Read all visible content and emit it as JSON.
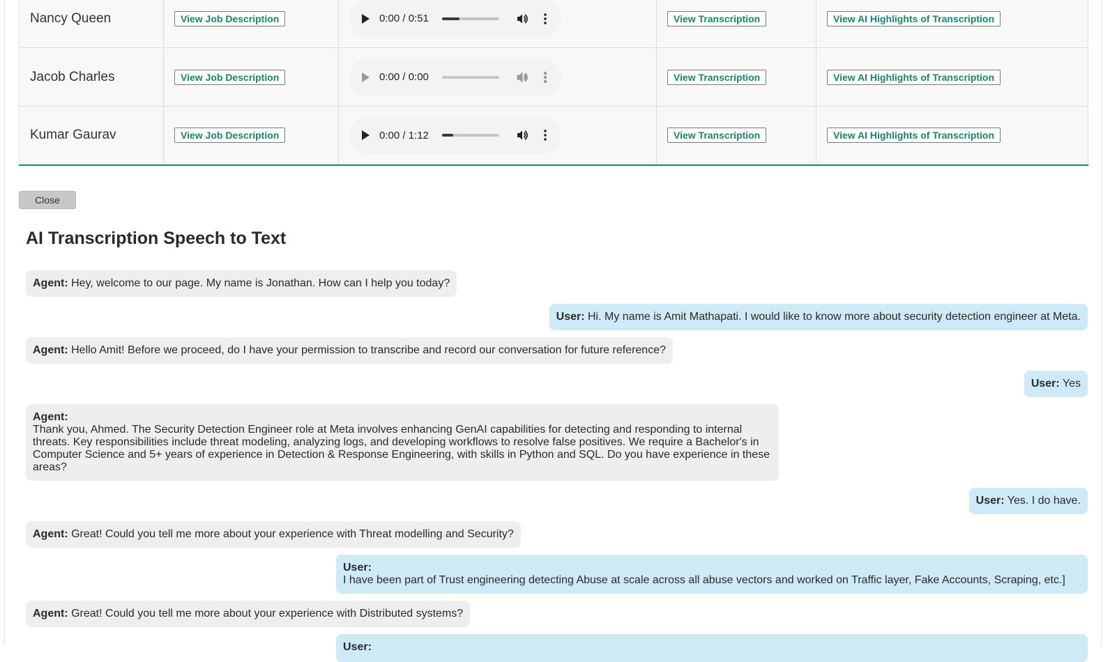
{
  "table": {
    "rows": [
      {
        "name": "Nancy Queen",
        "job_btn": "View Job Description",
        "audio": {
          "time": "0:00 / 0:51",
          "progress": 0.3,
          "disabled": false
        },
        "transcription_btn": "View Transcription",
        "highlights_btn": "View AI Highlights of Transcription"
      },
      {
        "name": "Jacob Charles",
        "job_btn": "View Job Description",
        "audio": {
          "time": "0:00 / 0:00",
          "progress": 0,
          "disabled": true
        },
        "transcription_btn": "View Transcription",
        "highlights_btn": "View AI Highlights of Transcription"
      },
      {
        "name": "Kumar Gaurav",
        "job_btn": "View Job Description",
        "audio": {
          "time": "0:00 / 1:12",
          "progress": 0.2,
          "disabled": false
        },
        "transcription_btn": "View Transcription",
        "highlights_btn": "View AI Highlights of Transcription"
      }
    ]
  },
  "close_label": "Close",
  "section_title": "AI Transcription Speech to Text",
  "messages": [
    {
      "role": "agent",
      "speaker": "Agent:",
      "text": "Hey, welcome to our page. My name is Jonathan. How can I help you today?"
    },
    {
      "role": "user",
      "speaker": "User:",
      "text": "Hi. My name is Amit Mathapati. I would like to know more about security detection engineer at Meta."
    },
    {
      "role": "agent",
      "speaker": "Agent:",
      "text": "Hello Amit! Before we proceed, do I have your permission to transcribe and record our conversation for future reference?"
    },
    {
      "role": "user",
      "speaker": "User:",
      "text": "Yes"
    },
    {
      "role": "agent",
      "speaker": "Agent:",
      "text": "Thank you, Ahmed. The Security Detection Engineer role at Meta involves enhancing GenAI capabilities for detecting and responding to internal threats. Key responsibilities include threat modeling, analyzing logs, and developing workflows to resolve false positives. We require a Bachelor's in Computer Science and 5+ years of experience in Detection & Response Engineering, with skills in Python and SQL. Do you have experience in these areas?"
    },
    {
      "role": "user",
      "speaker": "User:",
      "text": "Yes. I do have."
    },
    {
      "role": "agent",
      "speaker": "Agent:",
      "text": "Great! Could you tell me more about your experience with Threat modelling and Security?"
    },
    {
      "role": "user",
      "speaker": "User:",
      "text": "I have been part of Trust engineering detecting Abuse at scale across all abuse vectors and worked on Traffic layer, Fake Accounts, Scraping, etc.]"
    },
    {
      "role": "agent",
      "speaker": "Agent:",
      "text": "Great! Could you tell me more about your experience with Distributed systems?"
    },
    {
      "role": "user",
      "speaker": "User:",
      "text": ""
    }
  ]
}
